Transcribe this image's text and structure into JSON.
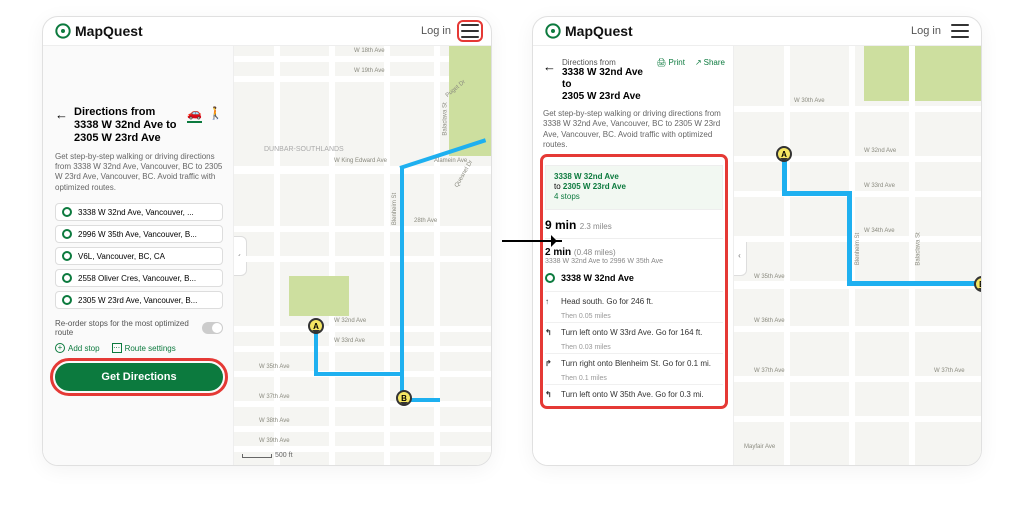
{
  "brand": "MapQuest",
  "login_label": "Log in",
  "left": {
    "title": "Directions from 3338 W 32nd Ave to 2305 W 23rd Ave",
    "desc": "Get step-by-step walking or driving directions from 3338 W 32nd Ave, Vancouver, BC to 2305 W 23rd Ave, Vancouver, BC. Avoid traffic with optimized routes.",
    "stops": [
      "3338 W 32nd Ave, Vancouver, ...",
      "2996 W 35th Ave, Vancouver, B...",
      "V6L, Vancouver, BC, CA",
      "2558 Oliver Cres, Vancouver, B...",
      "2305 W 23rd Ave, Vancouver, B..."
    ],
    "reorder_label": "Re-order stops for the most optimized route",
    "add_stop": "Add stop",
    "route_settings": "Route settings",
    "get_directions": "Get Directions",
    "neighborhood": "DUNBAR-SOUTHLANDS",
    "streets": {
      "w18": "W 18th Ave",
      "w19": "W 19th Ave",
      "wke": "W King Edward Ave",
      "alamein": "Alamein Ave",
      "w28": "28th Ave",
      "w32": "W 32nd Ave",
      "w33": "W 33rd Ave",
      "w35": "W 35th Ave",
      "w37": "W 37th Ave",
      "w38": "W 38th Ave",
      "w39": "W 39th Ave",
      "blenheim": "Blenheim St",
      "balaclava": "Balaclava St",
      "puget": "Puget Dr",
      "quesnel": "Quesnel Dr"
    },
    "scale": "500 ft",
    "pins": {
      "a": "A",
      "b": "B"
    }
  },
  "right": {
    "title_prefix": "Directions from",
    "title_from": "3338 W 32nd Ave to",
    "title_to": "2305 W 23rd Ave",
    "print": "Print",
    "share": "Share",
    "desc": "Get step-by-step walking or driving directions from 3338 W 32nd Ave, Vancouver, BC to 2305 W 23rd Ave, Vancouver, BC. Avoid traffic with optimized routes.",
    "summary_from": "3338 W 32nd Ave",
    "summary_to_prefix": "to ",
    "summary_to": "2305 W 23rd Ave",
    "summary_stops": "4 stops",
    "eta": "9 min",
    "eta_dist": "2.3 miles",
    "seg_time": "2 min",
    "seg_dist": "(0.48 miles)",
    "seg_desc": "3338 W 32nd Ave to 2996 W 35th Ave",
    "origin": "3338 W 32nd Ave",
    "steps": [
      {
        "icon": "↑",
        "text": "Head south. Go for 246 ft.",
        "after": "Then 0.05 miles"
      },
      {
        "icon": "↰",
        "text": "Turn left onto W 33rd Ave. Go for 164 ft.",
        "after": "Then 0.03 miles"
      },
      {
        "icon": "↱",
        "text": "Turn right onto Blenheim St. Go for 0.1 mi.",
        "after": "Then 0.1 miles"
      },
      {
        "icon": "↰",
        "text": "Turn left onto W 35th Ave. Go for 0.3 mi.",
        "after": ""
      }
    ],
    "streets": {
      "w30": "W 30th Ave",
      "w32": "W 32nd Ave",
      "w33": "W 33rd Ave",
      "w34": "W 34th Ave",
      "w35": "W 35th Ave",
      "w36": "W 36th Ave",
      "w37": "W 37th Ave",
      "blenheim": "Blenheim St",
      "balaclava": "Balaclava St",
      "mayfair": "Mayfair Ave"
    }
  }
}
